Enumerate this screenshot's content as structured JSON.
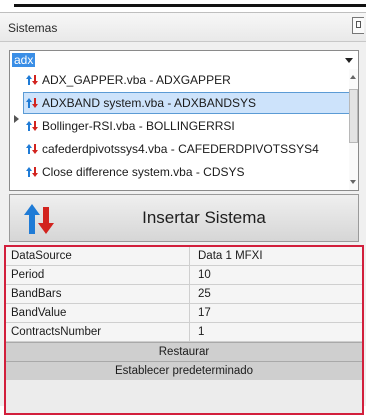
{
  "panel": {
    "title": "Sistemas"
  },
  "search": {
    "value": "adx"
  },
  "systems": [
    {
      "label": "ADX_GAPPER.vba - ADXGAPPER",
      "icon": "up-down-arrows-icon"
    },
    {
      "label": "ADXBAND system.vba - ADXBANDSYS",
      "icon": "up-down-arrows-icon",
      "selected": true
    },
    {
      "label": "Bollinger-RSI.vba - BOLLINGERRSI",
      "icon": "up-down-arrows-icon"
    },
    {
      "label": "cafederdpivotssys4.vba - CAFEDERDPIVOTSSYS4",
      "icon": "up-down-arrows-icon"
    },
    {
      "label": "Close difference system.vba - CDSYS",
      "icon": "up-down-arrows-icon"
    }
  ],
  "insert_button": {
    "label": "Insertar Sistema"
  },
  "properties": [
    {
      "name": "DataSource",
      "value": "Data 1 MFXI"
    },
    {
      "name": "Period",
      "value": "10"
    },
    {
      "name": "BandBars",
      "value": "25"
    },
    {
      "name": "BandValue",
      "value": "17"
    },
    {
      "name": "ContractsNumber",
      "value": "1"
    }
  ],
  "actions": {
    "restore_label": "Restaurar",
    "default_label": "Establecer predeterminado"
  },
  "colors": {
    "selection": "#cde3fb",
    "search_highlight": "#3a8ee6",
    "arrow_up": "#1f7bd6",
    "arrow_down": "#d2231e",
    "props_border": "#d21f3c"
  }
}
